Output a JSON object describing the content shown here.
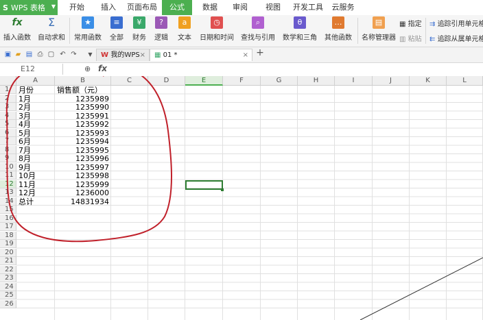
{
  "app": {
    "name": "WPS 表格"
  },
  "menu_tabs": [
    "开始",
    "插入",
    "页面布局",
    "公式",
    "数据",
    "审阅",
    "视图",
    "开发工具",
    "云服务"
  ],
  "ribbon": {
    "insert_function": "插入函数",
    "autosum": "自动求和",
    "common_functions": "常用函数",
    "all": "全部",
    "finance": "财务",
    "logic": "逻辑",
    "text": "文本",
    "datetime": "日期和时间",
    "lookup": "查找与引用",
    "math": "数学和三角",
    "other": "其他函数",
    "name_manager": "名称管理器",
    "define": "指定",
    "paste": "粘贴",
    "trace_precedents": "追踪引用单元格",
    "trace_dependents": "追踪从属单元格"
  },
  "doc_tabs": {
    "home": "我的WPS",
    "file": "01 *"
  },
  "formula_bar": {
    "cell_ref": "E12",
    "fx": "fx"
  },
  "columns": [
    "A",
    "B",
    "C",
    "D",
    "E",
    "F",
    "G",
    "H",
    "I",
    "J",
    "K",
    "L"
  ],
  "selected_column": "E",
  "selected_row": "12",
  "rows": [
    "1",
    "2",
    "3",
    "4",
    "5",
    "6",
    "7",
    "8",
    "9",
    "10",
    "11",
    "12",
    "13",
    "14",
    "15",
    "16",
    "17",
    "18",
    "19",
    "20",
    "21",
    "22",
    "23",
    "24",
    "25",
    "26"
  ],
  "table": {
    "header": {
      "month": "月份",
      "sales": "销售额（元）"
    },
    "data": [
      {
        "month": "1月",
        "sales": "1235989"
      },
      {
        "month": "2月",
        "sales": "1235990"
      },
      {
        "month": "3月",
        "sales": "1235991"
      },
      {
        "month": "4月",
        "sales": "1235992"
      },
      {
        "month": "5月",
        "sales": "1235993"
      },
      {
        "month": "6月",
        "sales": "1235994"
      },
      {
        "month": "7月",
        "sales": "1235995"
      },
      {
        "month": "8月",
        "sales": "1235996"
      },
      {
        "month": "9月",
        "sales": "1235997"
      },
      {
        "month": "10月",
        "sales": "1235998"
      },
      {
        "month": "11月",
        "sales": "1235999"
      },
      {
        "month": "12月",
        "sales": "1236000"
      }
    ],
    "total": {
      "month": "总计",
      "sales": "14831934"
    }
  }
}
